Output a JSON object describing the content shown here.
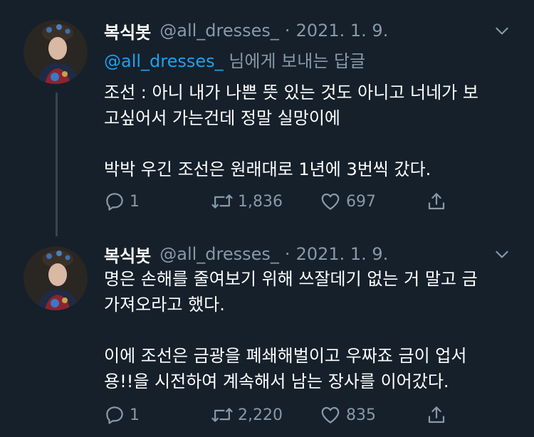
{
  "tweets": [
    {
      "name": "복식봇",
      "handle": "@all_dresses_",
      "dot": "·",
      "date": "2021. 1. 9.",
      "reply_mention": "@all_dresses_",
      "reply_suffix": " 님에게 보내는 답글",
      "lines": [
        "조선 : 아니 내가 나쁜 뜻 있는 것도 아니고 너네가 보",
        "고싶어서 가는건데 정말 실망이에",
        "",
        "박박 우긴 조선은 원래대로 1년에 3번씩 갔다."
      ],
      "replies": "1",
      "retweets": "1,836",
      "likes": "697"
    },
    {
      "name": "복식봇",
      "handle": "@all_dresses_",
      "dot": "·",
      "date": "2021. 1. 9.",
      "lines": [
        "명은 손해를 줄여보기 위해 쓰잘데기 없는 거 말고 금",
        "가져오라고 했다.",
        "",
        "이에 조선은 금광을 폐쇄해벌이고 우짜죠 금이 업서",
        "용!!을 시전하여 계속해서 남는 장사를 이어갔다."
      ],
      "replies": "1",
      "retweets": "2,220",
      "likes": "835"
    }
  ],
  "icons": {
    "reply": "reply-icon",
    "retweet": "retweet-icon",
    "like": "heart-icon",
    "share": "share-icon",
    "menu": "chevron-down-icon"
  },
  "colors": {
    "background": "#15202b",
    "secondary_text": "#8899a6",
    "link": "#1da1f2",
    "thread_line": "#38444d"
  }
}
